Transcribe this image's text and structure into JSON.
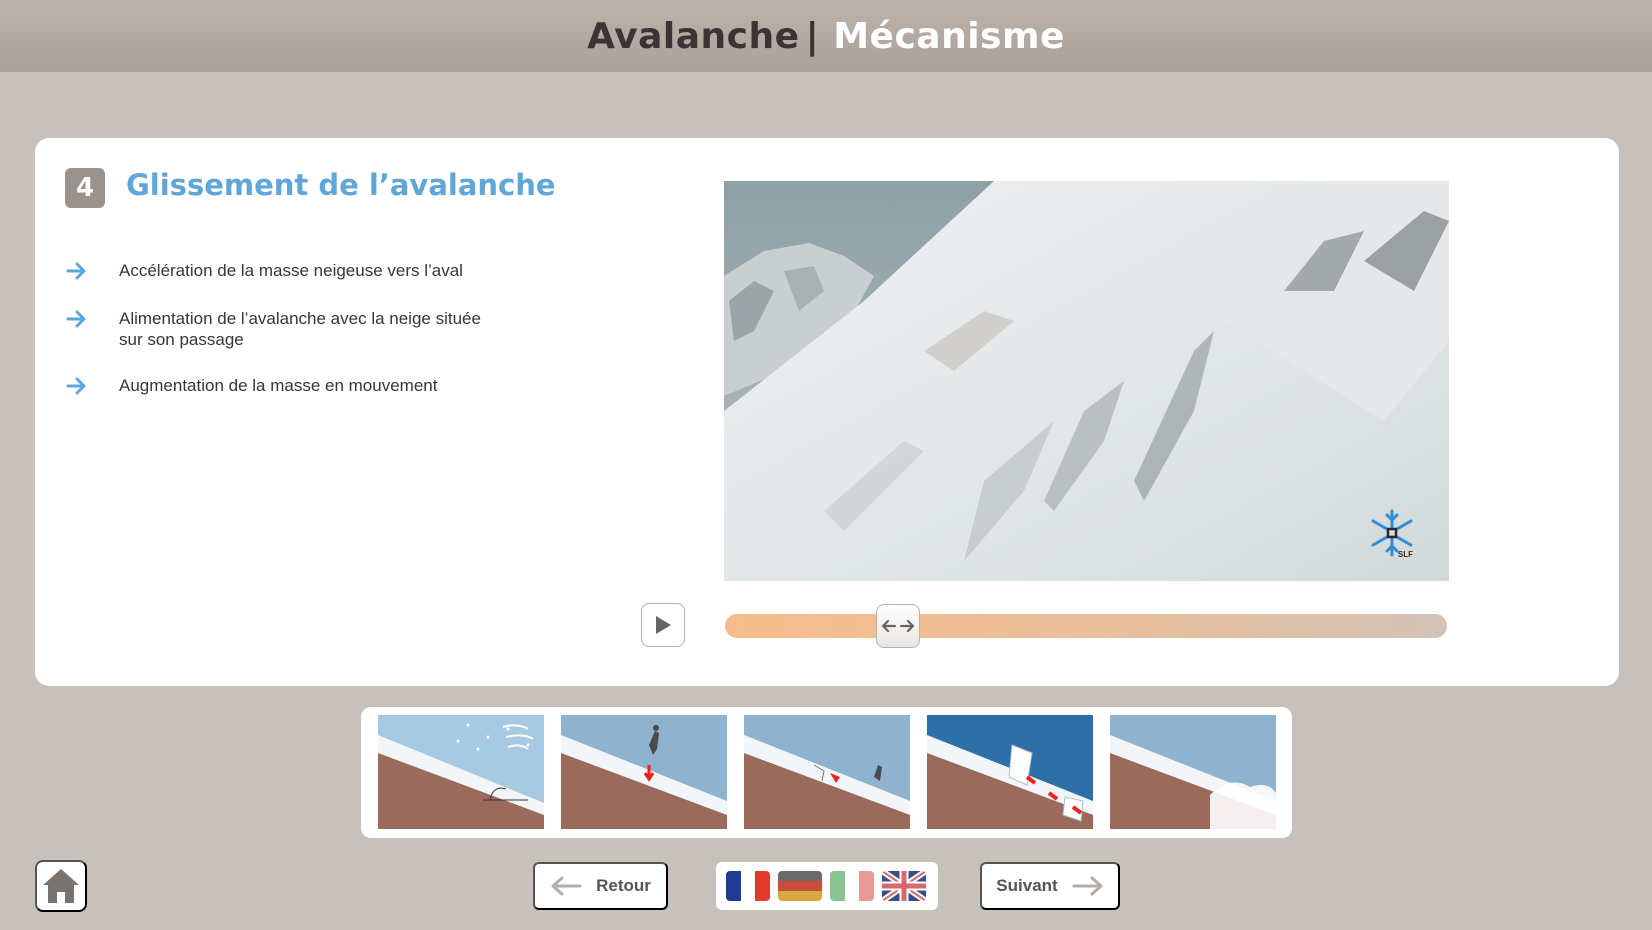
{
  "header": {
    "title": "Avalanche",
    "separator": "|",
    "subtitle": "Mécanisme"
  },
  "step": {
    "number": "4",
    "title": "Glissement de l’avalanche",
    "bullets": [
      "Accélération de la masse neigeuse vers l’aval",
      "Alimentation de l’avalanche avec la neige située\nsur son passage",
      "Augmentation de la masse en mouvement"
    ]
  },
  "video": {
    "logo_text": "SLF",
    "progress": 0.24
  },
  "thumbnails": [
    {
      "name": "snow-accumulation"
    },
    {
      "name": "skier-trigger"
    },
    {
      "name": "fracture"
    },
    {
      "name": "slab-release"
    },
    {
      "name": "avalanche-flow"
    }
  ],
  "nav": {
    "back_label": "Retour",
    "next_label": "Suivant"
  },
  "languages": [
    "fr",
    "de",
    "it",
    "en"
  ],
  "icons": {
    "bullet": "arrow-right-icon",
    "home": "home-icon",
    "play": "play-icon",
    "slider_handle": "left-right-arrows-icon"
  },
  "colors": {
    "accent_blue": "#5fa6d9",
    "header_bg": "#b3a99f",
    "page_bg": "#c7c1bb",
    "badge_bg": "#9a928c",
    "slider_fill": "#f6bd8c"
  }
}
